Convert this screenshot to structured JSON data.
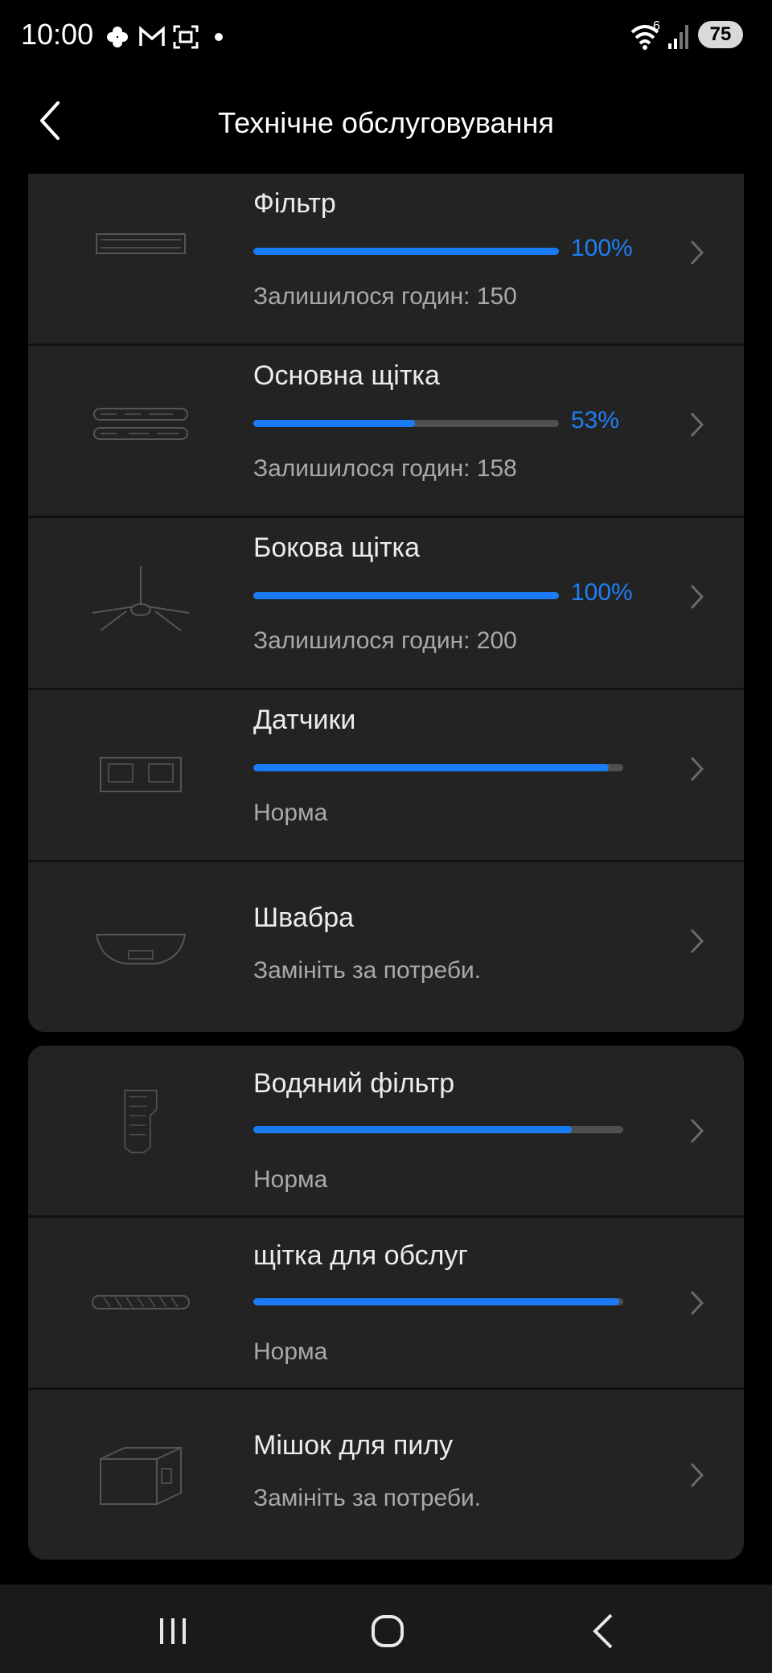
{
  "status_bar": {
    "time": "10:00",
    "icons": [
      "pinwheel-icon",
      "mail-icon",
      "screenshot-icon",
      "dot-icon"
    ],
    "wifi_badge": "6",
    "battery": "75"
  },
  "header": {
    "title": "Технічне обслуговування"
  },
  "group1": [
    {
      "name": "Фільтр",
      "progress": 1.0,
      "percent": "100%",
      "sub": "Залишилося годин: 150",
      "icon": "filter-image"
    },
    {
      "name": "Основна щітка",
      "progress": 0.53,
      "percent": "53%",
      "sub": "Залишилося годин: 158",
      "icon": "main-brush-image"
    },
    {
      "name": "Бокова щітка",
      "progress": 1.0,
      "percent": "100%",
      "sub": "Залишилося годин: 200",
      "icon": "side-brush-image"
    },
    {
      "name": "Датчики",
      "progress": 0.96,
      "sub": "Норма",
      "icon": "sensors-image"
    },
    {
      "name": "Швабра",
      "sub": "Замініть за потреби.",
      "icon": "mop-image"
    }
  ],
  "group2": [
    {
      "name": "Водяний фільтр",
      "progress": 0.86,
      "sub": "Норма",
      "icon": "water-filter-image"
    },
    {
      "name": "щітка для обслуг",
      "progress": 0.99,
      "sub": "Норма",
      "icon": "maintenance-brush-image"
    },
    {
      "name": "Мішок для пилу",
      "sub": "Замініть за потреби.",
      "icon": "dust-bag-image"
    }
  ],
  "colors": {
    "accent": "#1a7cf5",
    "card": "#232323",
    "background": "#000000"
  }
}
